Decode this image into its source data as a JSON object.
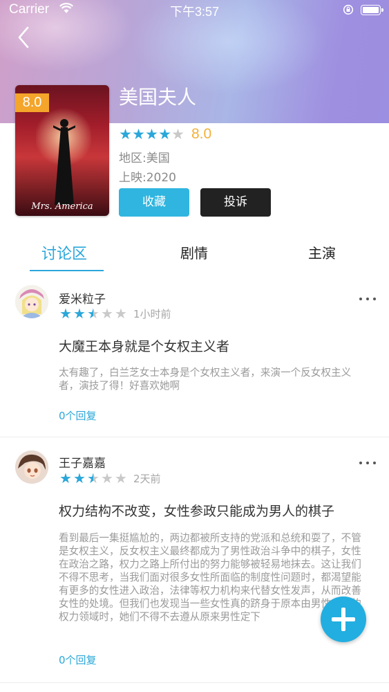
{
  "status_bar": {
    "carrier": "Carrier",
    "time": "下午3:57"
  },
  "movie": {
    "title": "美国夫人",
    "score_badge": "8.0",
    "rating": "8.0",
    "star_count": 4,
    "star_total": 5,
    "region": "地区:美国",
    "release": "上映:2020",
    "poster_text": "Mrs. America"
  },
  "actions": {
    "collect_label": "收藏",
    "report_label": "投诉"
  },
  "tabs": [
    {
      "label": "讨论区",
      "active": true
    },
    {
      "label": "剧情",
      "active": false
    },
    {
      "label": "主演",
      "active": false
    }
  ],
  "posts": [
    {
      "username": "爱米粒子",
      "stars": 2.5,
      "time": "1小时前",
      "title": "大魔王本身就是个女权主义者",
      "body": "太有趣了，白兰芝女士本身是个女权主义者，来演一个反女权主义者，演技了得！好喜欢她啊",
      "replies": "0个回复"
    },
    {
      "username": "王子嘉嘉",
      "stars": 2.5,
      "time": "2天前",
      "title": "权力结构不改变，女性参政只能成为男人的棋子",
      "body": "看到最后一集挺尴尬的，两边都被所支持的党派和总统和耍了，不管是女权主义，反女权主义最终都成为了男性政治斗争中的棋子，女性在政治之路，权力之路上所付出的努力能够被轻易地抹去。这让我们不得不思考，当我们面对很多女性所面临的制度性问题时，都渴望能有更多的女性进入政治，法律等权力机构来代替女性发声，从而改善女性的处境。但我们也发现当一些女性真的跻身于原本由男性主宰的权力领域时，她们不得不去遵从原来男性定下",
      "replies": "0个回复"
    }
  ],
  "colors": {
    "accent": "#2aa7d9",
    "star_gold": "#f3b037",
    "badge": "#f4a52a",
    "dark_button": "#222222"
  }
}
